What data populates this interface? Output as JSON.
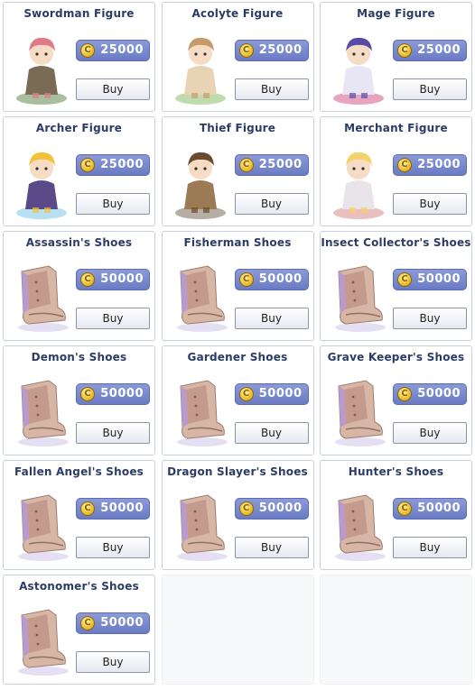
{
  "currency_symbol": "C",
  "buy_label": "Buy",
  "colors": {
    "title": "#2b3c66",
    "price_bg": "#7887cc",
    "coin": "#e6b520",
    "card_border": "#c9cfdc"
  },
  "items": [
    {
      "name": "Swordman Figure",
      "price": "25000",
      "icon": "swordman-figure-icon"
    },
    {
      "name": "Acolyte Figure",
      "price": "25000",
      "icon": "acolyte-figure-icon"
    },
    {
      "name": "Mage Figure",
      "price": "25000",
      "icon": "mage-figure-icon"
    },
    {
      "name": "Archer Figure",
      "price": "25000",
      "icon": "archer-figure-icon"
    },
    {
      "name": "Thief Figure",
      "price": "25000",
      "icon": "thief-figure-icon"
    },
    {
      "name": "Merchant Figure",
      "price": "25000",
      "icon": "merchant-figure-icon"
    },
    {
      "name": "Assassin's Shoes",
      "price": "50000",
      "icon": "shoes-icon"
    },
    {
      "name": "Fisherman Shoes",
      "price": "50000",
      "icon": "shoes-icon"
    },
    {
      "name": "Insect Collector's Shoes",
      "price": "50000",
      "icon": "shoes-icon"
    },
    {
      "name": "Demon's Shoes",
      "price": "50000",
      "icon": "shoes-icon"
    },
    {
      "name": "Gardener Shoes",
      "price": "50000",
      "icon": "shoes-icon"
    },
    {
      "name": "Grave Keeper's Shoes",
      "price": "50000",
      "icon": "shoes-icon"
    },
    {
      "name": "Fallen Angel's Shoes",
      "price": "50000",
      "icon": "shoes-icon"
    },
    {
      "name": "Dragon Slayer's Shoes",
      "price": "50000",
      "icon": "shoes-icon"
    },
    {
      "name": "Hunter's Shoes",
      "price": "50000",
      "icon": "shoes-icon"
    },
    {
      "name": "Astonomer's Shoes",
      "price": "50000",
      "icon": "shoes-icon"
    }
  ]
}
